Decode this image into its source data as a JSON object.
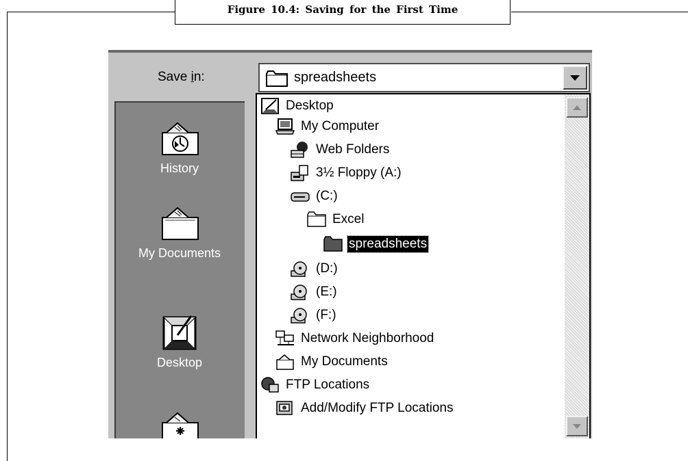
{
  "caption": "Figure 10.4: Saving for the First Time",
  "dialog": {
    "save_in_label": "Save in:",
    "save_in_value": "spreadsheets",
    "places": [
      {
        "label": "History",
        "icon": "history-folder-icon"
      },
      {
        "label": "My Documents",
        "icon": "my-documents-folder-icon"
      },
      {
        "label": "Desktop",
        "icon": "desktop-icon"
      },
      {
        "label": "",
        "icon": "favorites-folder-icon"
      }
    ],
    "dropdown_items": [
      {
        "label": "Desktop",
        "icon": "desktop-icon",
        "level": 0
      },
      {
        "label": "My Computer",
        "icon": "computer-icon",
        "level": 1
      },
      {
        "label": "Web Folders",
        "icon": "web-folder-icon",
        "level": 2
      },
      {
        "label": "3½ Floppy (A:)",
        "icon": "floppy-drive-icon",
        "level": 2
      },
      {
        "label": "(C:)",
        "icon": "hard-drive-icon",
        "level": 2
      },
      {
        "label": "Excel",
        "icon": "folder-icon",
        "level": 3
      },
      {
        "label": "spreadsheets",
        "icon": "folder-icon",
        "level": 4,
        "selected": true
      },
      {
        "label": "(D:)",
        "icon": "cd-drive-icon",
        "level": 2
      },
      {
        "label": "(E:)",
        "icon": "cd-drive-icon",
        "level": 2
      },
      {
        "label": "(F:)",
        "icon": "cd-drive-icon",
        "level": 2
      },
      {
        "label": "Network Neighborhood",
        "icon": "network-icon",
        "level": 1
      },
      {
        "label": "My Documents",
        "icon": "documents-folder-icon",
        "level": 1
      },
      {
        "label": "FTP Locations",
        "icon": "ftp-icon",
        "level": 0
      },
      {
        "label": "Add/Modify FTP Locations",
        "icon": "ftp-add-icon",
        "level": 1
      }
    ]
  }
}
